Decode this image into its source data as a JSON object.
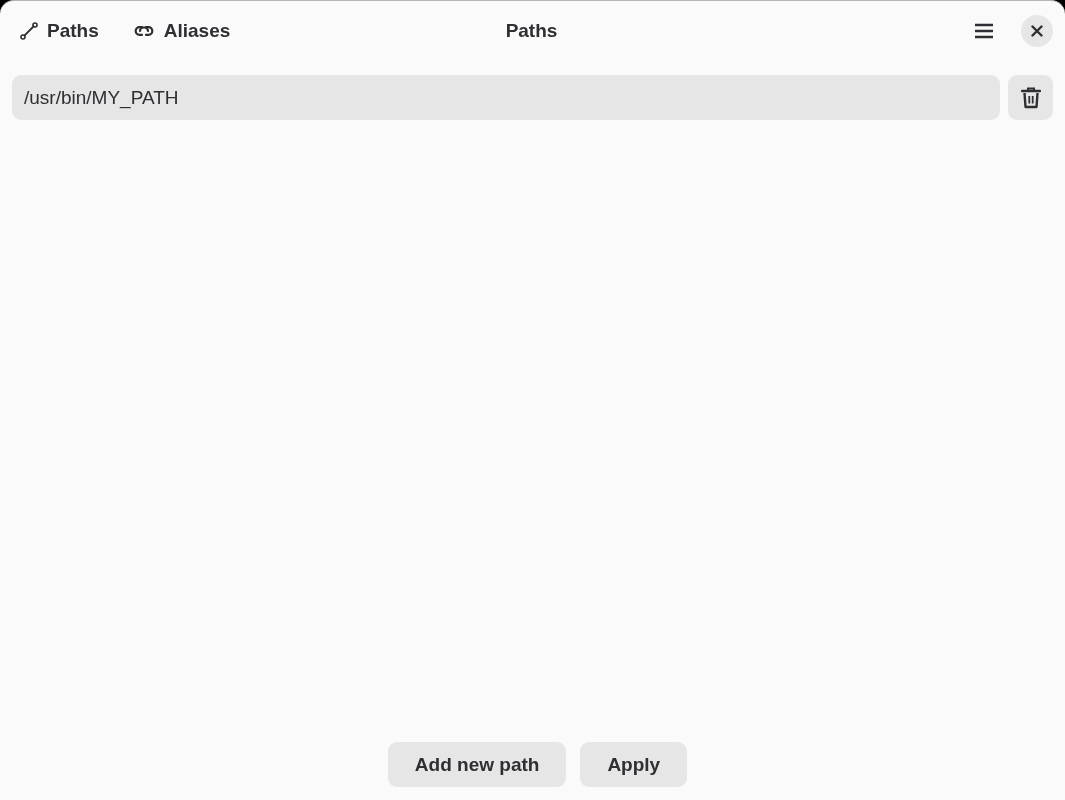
{
  "header": {
    "tabs": [
      {
        "label": "Paths",
        "kind": "path"
      },
      {
        "label": "Aliases",
        "kind": "link"
      }
    ],
    "title": "Paths"
  },
  "paths": [
    {
      "value": "/usr/bin/MY_PATH"
    }
  ],
  "buttons": [
    {
      "label": "Add new path"
    },
    {
      "label": "Apply"
    }
  ]
}
